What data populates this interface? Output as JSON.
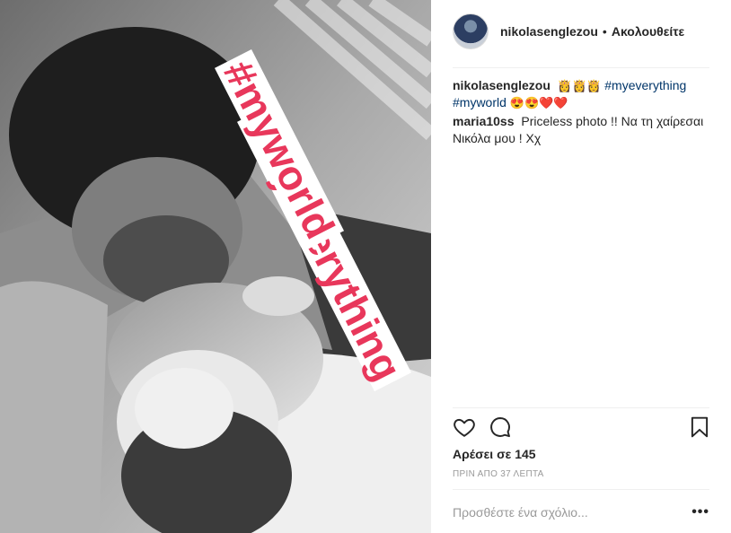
{
  "post": {
    "photo_alt": "",
    "overlay_tags": [
      "#myeverything",
      "#myworld"
    ]
  },
  "header": {
    "username": "nikolasenglezou",
    "separator": "•",
    "follow_label": "Ακολουθείτε"
  },
  "comments": [
    {
      "user": "nikolasenglezou",
      "emoji_prefix": "👸👸👸",
      "tags": [
        "#myeverything",
        "#myworld"
      ],
      "emoji_suffix": "😍😍❤️❤️"
    },
    {
      "user": "maria10ss",
      "text": "Priceless photo !! Να τη χαίρεσαι Νικόλα μου ! Χχ"
    }
  ],
  "actions": {
    "like_icon": "heart-icon",
    "comment_icon": "speech-bubble-icon",
    "save_icon": "bookmark-icon"
  },
  "likes_text": "Αρέσει σε 145",
  "timestamp": "ΠΡΙΝ ΑΠΟ 37 ΛΕΠΤΑ",
  "add_comment": {
    "placeholder": "Προσθέστε ένα σχόλιο...",
    "more_label": "•••"
  },
  "colors": {
    "hashtag": "#003569",
    "overlay_text": "#e8375b"
  }
}
